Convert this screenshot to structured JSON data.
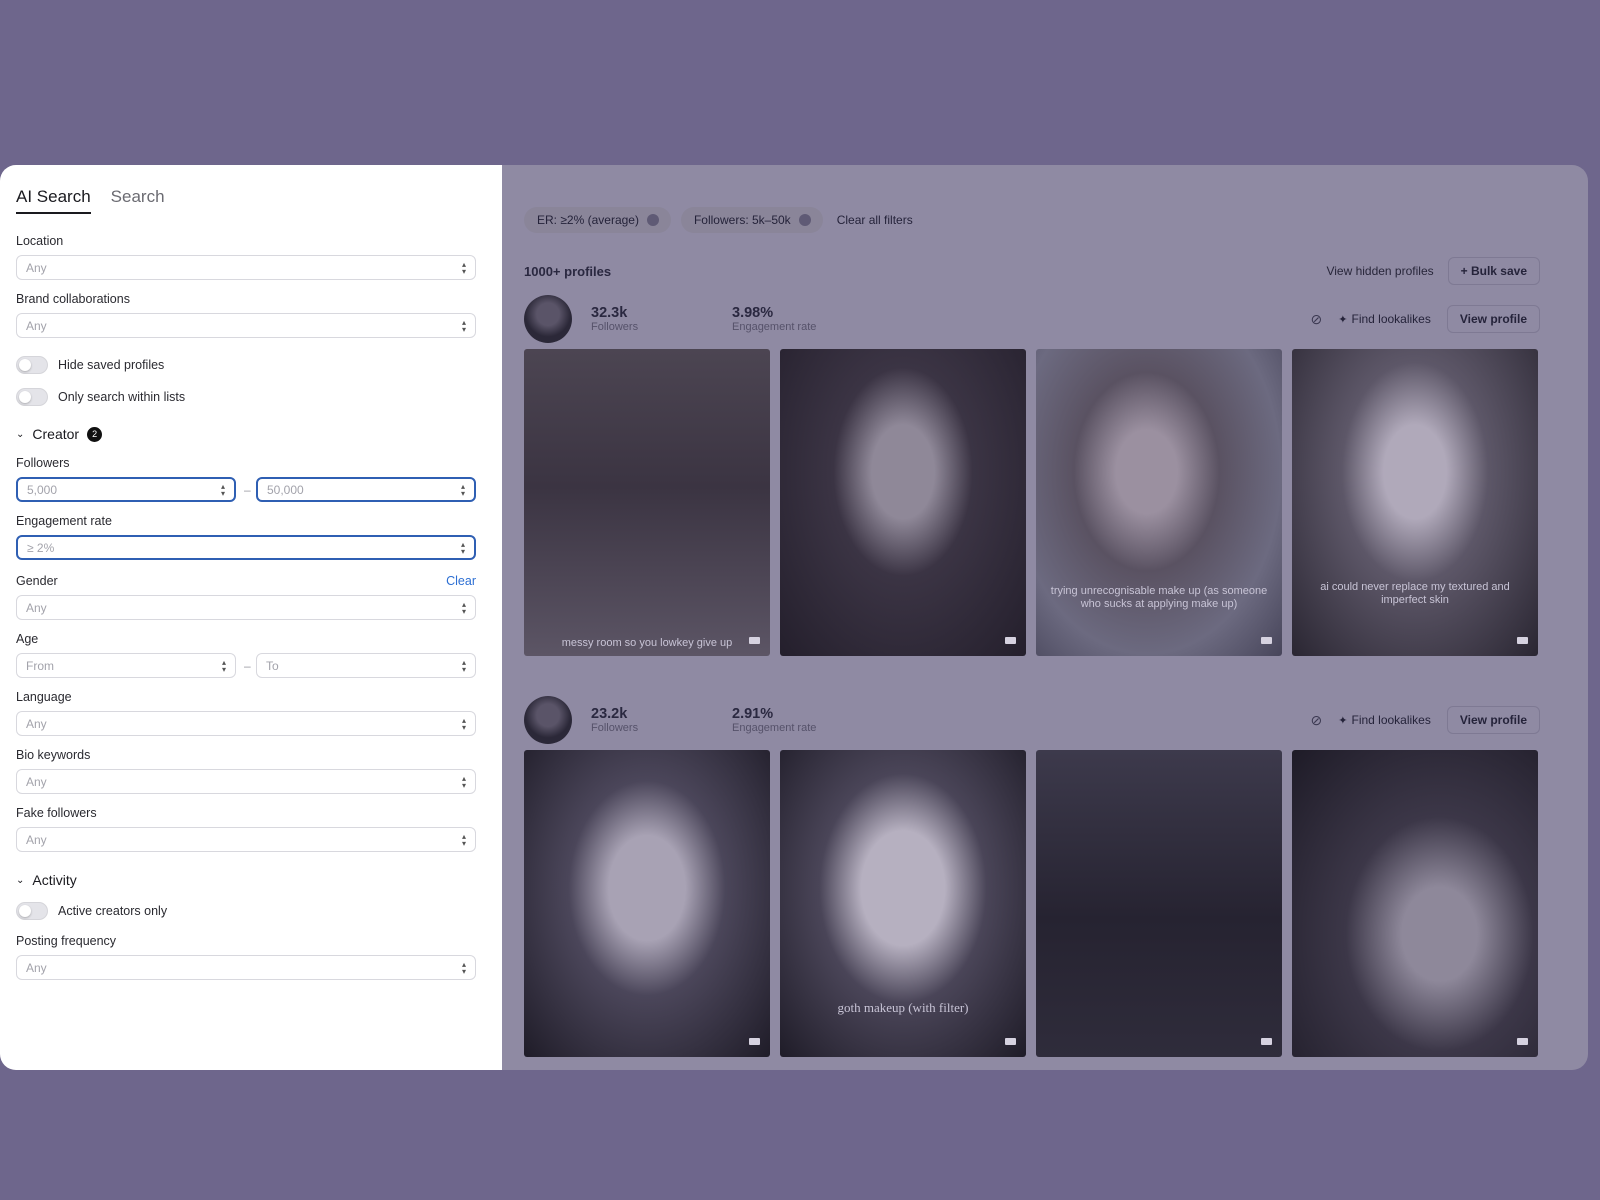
{
  "sidebar": {
    "tabs": [
      {
        "label": "AI Search",
        "active": true
      },
      {
        "label": "Search",
        "active": false
      }
    ],
    "location": {
      "label": "Location",
      "value": "Any"
    },
    "brand": {
      "label": "Brand collaborations",
      "value": "Any"
    },
    "toggles": {
      "hide_saved": "Hide saved profiles",
      "only_lists": "Only search within lists"
    },
    "creator_section": {
      "title": "Creator",
      "badge": "2"
    },
    "followers": {
      "label": "Followers",
      "min": "5,000",
      "max": "50,000",
      "sep": "–"
    },
    "engagement": {
      "label": "Engagement rate",
      "value": "≥ 2%"
    },
    "gender": {
      "label": "Gender",
      "clear": "Clear",
      "value": "Any"
    },
    "age": {
      "label": "Age",
      "from": "From",
      "to": "To",
      "sep": "–"
    },
    "language": {
      "label": "Language",
      "value": "Any"
    },
    "bio": {
      "label": "Bio keywords",
      "value": "Any"
    },
    "fake": {
      "label": "Fake followers",
      "value": "Any"
    },
    "activity_section": {
      "title": "Activity"
    },
    "active_only": "Active creators only",
    "posting": {
      "label": "Posting frequency",
      "value": "Any"
    }
  },
  "main": {
    "filter_chips": [
      "ER: ≥2% (average)",
      "Followers: 5k–50k"
    ],
    "clear_all": "Clear all filters",
    "count": "1000+ profiles",
    "view_hidden": "View hidden profiles",
    "bulk_save": "+ Bulk save",
    "find_lookalikes": "Find lookalikes",
    "view_profile": "View profile",
    "profiles": [
      {
        "followers": "32.3k",
        "followers_label": "Followers",
        "er": "3.98%",
        "er_label": "Engagement rate",
        "captions": [
          "messy room so you lowkey give up",
          "",
          "trying unrecognisable make up (as someone who sucks at applying make up)",
          "ai could never replace my textured and imperfect skin"
        ]
      },
      {
        "followers": "23.2k",
        "followers_label": "Followers",
        "er": "2.91%",
        "er_label": "Engagement rate",
        "captions": [
          "",
          "goth makeup (with filter)",
          "",
          ""
        ]
      }
    ]
  },
  "colors": {
    "background": "#6e668c",
    "overlay": "#8f8aa3",
    "accent_blue": "#2f5fb3"
  }
}
